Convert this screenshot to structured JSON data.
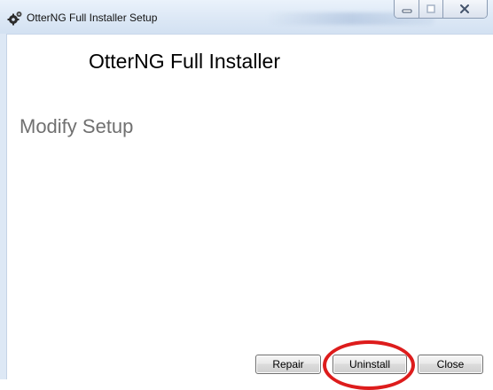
{
  "window": {
    "title": "OtterNG Full Installer Setup",
    "icon": "installer-gear-icon",
    "controls": [
      "minimize-icon",
      "maximize-icon",
      "close-icon"
    ]
  },
  "main": {
    "product_title": "OtterNG Full Installer",
    "section_title": "Modify Setup"
  },
  "buttons": {
    "repair": "Repair",
    "uninstall": "Uninstall",
    "close": "Close"
  },
  "annotation": {
    "highlight_target": "uninstall",
    "color": "#dd1c1c"
  },
  "colors": {
    "titlebar": "#dbe7f5",
    "section_title": "#707070"
  }
}
